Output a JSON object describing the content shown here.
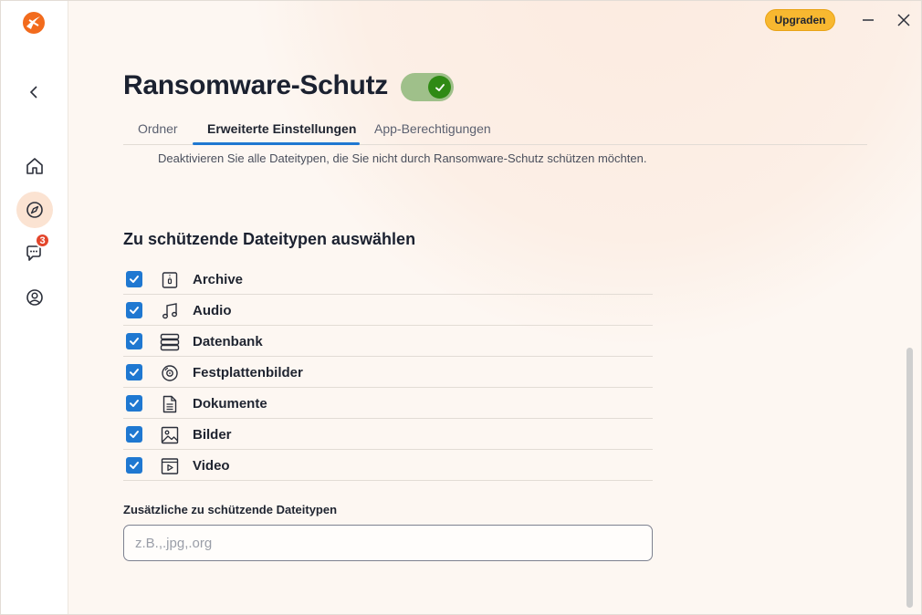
{
  "header": {
    "upgrade_label": "Upgraden"
  },
  "sidebar": {
    "chat_badge": "3"
  },
  "page": {
    "title": "Ransomware-Schutz",
    "toggle_on": true,
    "tabs": [
      {
        "label": "Ordner",
        "active": false
      },
      {
        "label": "Erweiterte Einstellungen",
        "active": true
      },
      {
        "label": "App-Berechtigungen",
        "active": false
      }
    ],
    "description": "Deaktivieren Sie alle Dateitypen, die Sie nicht durch Ransomware-Schutz schützen möchten."
  },
  "filetypes": {
    "title": "Zu schützende Dateitypen auswählen",
    "items": [
      {
        "label": "Archive",
        "icon": "archive-icon",
        "checked": true
      },
      {
        "label": "Audio",
        "icon": "music-note-icon",
        "checked": true
      },
      {
        "label": "Datenbank",
        "icon": "database-icon",
        "checked": true
      },
      {
        "label": "Festplattenbilder",
        "icon": "disc-icon",
        "checked": true
      },
      {
        "label": "Dokumente",
        "icon": "document-icon",
        "checked": true
      },
      {
        "label": "Bilder",
        "icon": "image-icon",
        "checked": true
      },
      {
        "label": "Video",
        "icon": "video-icon",
        "checked": true
      }
    ]
  },
  "additional": {
    "label": "Zusätzliche zu schützende Dateitypen",
    "placeholder": "z.B.,.jpg,.org",
    "value": ""
  },
  "colors": {
    "accent": "#1f78d1",
    "upgrade": "#f8b830",
    "toggle_knob": "#2f8a14",
    "brand": "#f26b1d"
  }
}
